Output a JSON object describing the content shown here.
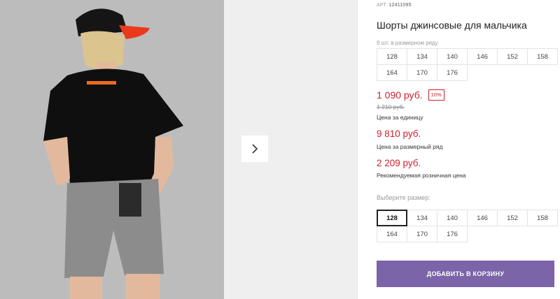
{
  "product": {
    "sku_label": "АРТ.",
    "sku": "12411095",
    "title": "Шорты джинсовые для мальчика",
    "size_row_count": "9 шт. в размерном ряду"
  },
  "size_row": [
    "128",
    "134",
    "140",
    "146",
    "152",
    "158",
    "164",
    "170",
    "176"
  ],
  "pricing": {
    "unit_price": "1 090 руб.",
    "discount_badge": "10%",
    "old_price": "1 210 руб.",
    "unit_price_label": "Цена за единицу",
    "row_price": "9 810 руб.",
    "row_price_label": "Цена за размерный ряд",
    "retail_price": "2 209 руб.",
    "retail_price_label": "Рекомендуемая розничная цена"
  },
  "size_select": {
    "label": "Выберите размер:",
    "selected": "128",
    "options": [
      "128",
      "134",
      "140",
      "146",
      "152",
      "158",
      "164",
      "170",
      "176"
    ]
  },
  "actions": {
    "add_to_cart": "ДОБАВИТЬ В КОРЗИНУ"
  },
  "colors": {
    "accent_price": "#d0202d",
    "button": "#7b64a8"
  },
  "icons": {
    "next": "chevron-right-icon"
  }
}
